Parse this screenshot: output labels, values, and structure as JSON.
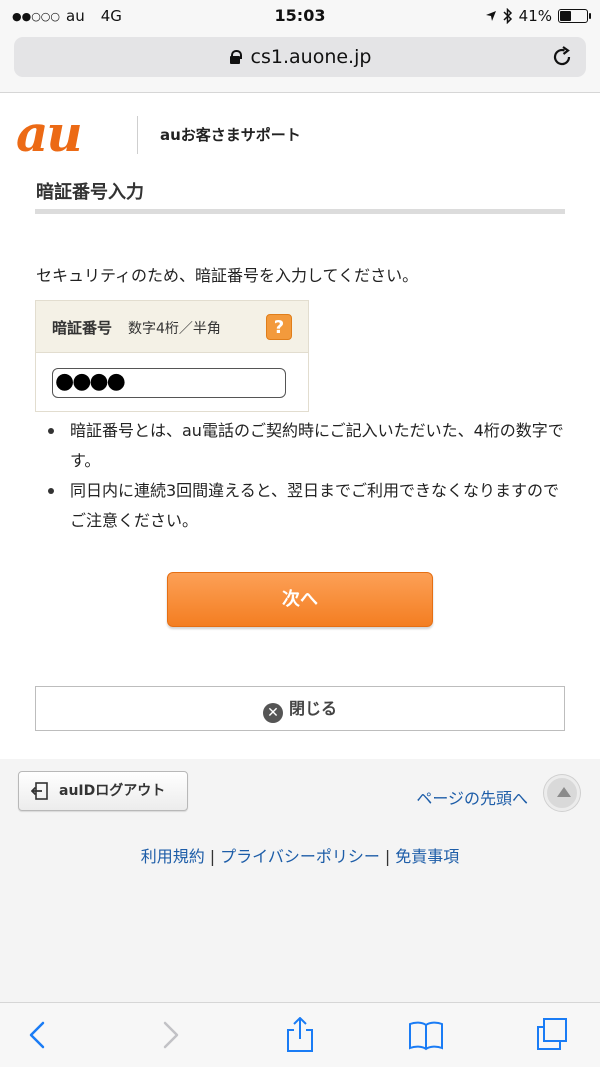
{
  "status_bar": {
    "signal": "●●○○○",
    "carrier": "au",
    "network": "4G",
    "time": "15:03",
    "battery": "41%",
    "battery_level": 0.41
  },
  "browser": {
    "url": "cs1.auone.jp"
  },
  "header": {
    "logo": "au",
    "support_title": "auお客さまサポート"
  },
  "page": {
    "title": "暗証番号入力",
    "instruction": "セキュリティのため、暗証番号を入力してください。",
    "pin_label": "暗証番号",
    "pin_hint": "数字4桁／半角",
    "help_icon": "?",
    "pin_value": "●●●●",
    "notes": [
      "暗証番号とは、au電話のご契約時にご記入いただいた、4桁の数字です。",
      "同日内に連続3回間違えると、翌日までご利用できなくなりますのでご注意ください。"
    ],
    "next_label": "次へ",
    "close_label": "閉じる"
  },
  "footer": {
    "logout_label": "auIDログアウト",
    "page_top_label": "ページの先頭へ",
    "links": [
      "利用規約",
      "プライバシーポリシー",
      "免責事項"
    ],
    "separator": "|"
  },
  "colors": {
    "brand": "#ec6a15",
    "button": "#f47e22",
    "link": "#1d5da8",
    "ios_blue": "#1a7cf5"
  },
  "icons": [
    "lock-icon",
    "reload-icon",
    "help-icon",
    "close-icon",
    "logout-icon",
    "arrow-up-icon",
    "back-icon",
    "forward-icon",
    "share-icon",
    "bookmarks-icon",
    "tabs-icon"
  ]
}
